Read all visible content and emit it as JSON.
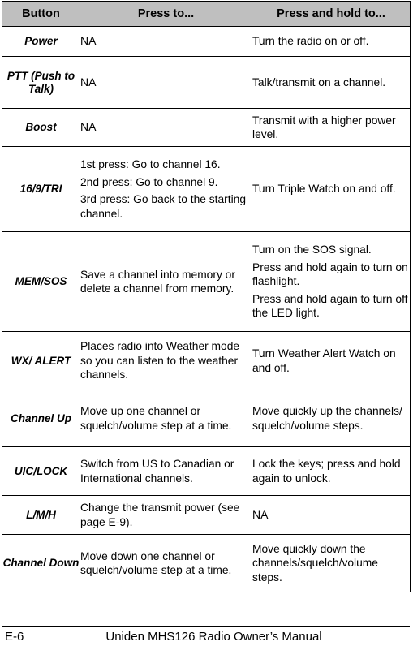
{
  "table": {
    "headers": [
      "Button",
      "Press to...",
      "Press and hold to..."
    ],
    "rows": [
      {
        "button": "Power",
        "press": [
          "NA"
        ],
        "hold": [
          "Turn the radio on or off."
        ]
      },
      {
        "button": "PTT (Push to Talk)",
        "press": [
          "NA"
        ],
        "hold": [
          "Talk/transmit on a channel."
        ]
      },
      {
        "button": "Boost",
        "press": [
          "NA"
        ],
        "hold": [
          "Transmit with a higher power level."
        ]
      },
      {
        "button": "16/9/TRI",
        "press": [
          "1st press: Go to channel 16.",
          "2nd press: Go to channel 9.",
          "3rd press: Go back to the starting channel."
        ],
        "hold": [
          "Turn Triple Watch on and off."
        ]
      },
      {
        "button": "MEM/SOS",
        "press": [
          "Save a channel into memory or delete a channel from memory."
        ],
        "hold": [
          "Turn on the SOS signal.",
          "Press and hold again to turn on flashlight.",
          "Press and hold again to turn off the LED light."
        ]
      },
      {
        "button": "WX/ ALERT",
        "press": [
          "Places radio into Weather mode so you can listen to the weather channels."
        ],
        "hold": [
          "Turn Weather Alert Watch on and off."
        ]
      },
      {
        "button": "Channel Up",
        "press": [
          "Move up one channel or squelch/volume step at a time."
        ],
        "hold": [
          "Move quickly up the channels/ squelch/volume steps."
        ]
      },
      {
        "button": "UIC/LOCK",
        "press": [
          "Switch from US to Canadian or International channels."
        ],
        "hold": [
          "Lock the keys; press and hold again to unlock."
        ]
      },
      {
        "button": "L/M/H",
        "press": [
          "Change the transmit power (see page E-9)."
        ],
        "hold": [
          "NA"
        ]
      },
      {
        "button": "Channel Down",
        "press": [
          "Move down one channel or squelch/volume step at a time."
        ],
        "hold": [
          "Move quickly down the channels/squelch/volume steps."
        ]
      }
    ]
  },
  "footer": {
    "page_number": "E-6",
    "manual_title": "Uniden MHS126 Radio Owner’s Manual"
  },
  "colors": {
    "header_background": "#bfbfbf",
    "border": "#000000",
    "text": "#000000",
    "page_background": "#ffffff"
  }
}
